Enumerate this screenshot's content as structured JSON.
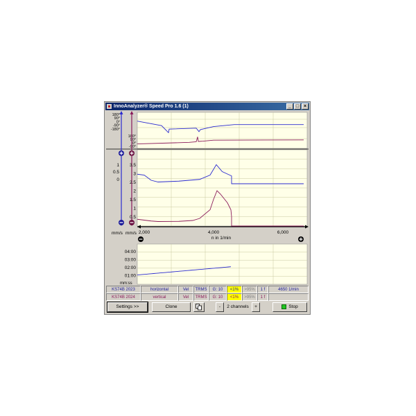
{
  "window": {
    "title": "InnoAnalyzer® Speed Pro 1.6 (1)"
  },
  "colors": {
    "trace_top": "#2a2ad0",
    "trace_bottom": "#8a1a5a",
    "plot_bg": "#ffffe8",
    "grid": "#c8c8a0",
    "yellow": "#ffff00"
  },
  "chart_data": [
    {
      "type": "line",
      "panel": "phase",
      "ytick_labels_ch1": [
        "180°",
        "90°",
        "0°",
        "-90°",
        "-180°"
      ],
      "ytick_labels_ch2": [
        "180°",
        "90°",
        "0°",
        "-90°"
      ],
      "series": [
        {
          "values": [
            [
              1800,
              60
            ],
            [
              2500,
              -30
            ],
            [
              2700,
              -170
            ],
            [
              2720,
              -100
            ],
            [
              3500,
              -80
            ],
            [
              3580,
              -150
            ],
            [
              3620,
              -110
            ],
            [
              4000,
              -50
            ],
            [
              4600,
              -10
            ],
            [
              6600,
              -10
            ]
          ]
        },
        {
          "values": [
            [
              1800,
              -170
            ],
            [
              3300,
              -120
            ],
            [
              3500,
              -100
            ],
            [
              3540,
              60
            ],
            [
              3560,
              -90
            ],
            [
              3700,
              -80
            ],
            [
              4000,
              -50
            ],
            [
              6600,
              -40
            ]
          ]
        }
      ]
    },
    {
      "type": "line",
      "panel": "velocity",
      "xlabel": "n in 1/min",
      "xticks": [
        "2,000",
        "4,000",
        "6,000"
      ],
      "xlim": [
        1800,
        6700
      ],
      "ylabel_left": "mm/s",
      "ylabel_right": "mm/s",
      "yticks_left": [
        "1",
        "0.5",
        "0"
      ],
      "yticks_right": [
        "3.5",
        "3",
        "2.5",
        "2",
        "1.5",
        "1",
        "0.5"
      ],
      "series": [
        {
          "values": [
            [
              1800,
              3.05
            ],
            [
              2000,
              3.0
            ],
            [
              2200,
              2.7
            ],
            [
              2400,
              2.6
            ],
            [
              3000,
              2.65
            ],
            [
              3600,
              2.75
            ],
            [
              3900,
              3.0
            ],
            [
              4080,
              3.6
            ],
            [
              4250,
              3.2
            ],
            [
              4520,
              2.95
            ],
            [
              4520,
              2.5
            ],
            [
              6600,
              2.5
            ]
          ]
        },
        {
          "values": [
            [
              1800,
              0.45
            ],
            [
              2000,
              0.4
            ],
            [
              2200,
              0.35
            ],
            [
              2400,
              0.32
            ],
            [
              3000,
              0.33
            ],
            [
              3400,
              0.38
            ],
            [
              3600,
              0.5
            ],
            [
              3900,
              1.0
            ],
            [
              4000,
              1.6
            ],
            [
              4100,
              2.1
            ],
            [
              4200,
              1.9
            ],
            [
              4400,
              1.4
            ],
            [
              4500,
              1.0
            ],
            [
              4520,
              0.6
            ],
            [
              4520,
              0.0
            ],
            [
              6600,
              0.0
            ]
          ]
        }
      ]
    },
    {
      "type": "line",
      "panel": "time",
      "ylabel": "mm:ss",
      "yticks": [
        "04:00",
        "03:00",
        "02:00",
        "01:00"
      ],
      "series": [
        {
          "values": [
            [
              0,
              70
            ],
            [
              1,
              132
            ]
          ]
        }
      ]
    }
  ],
  "status": {
    "rows": [
      {
        "sensor": "KS74B 2023",
        "direction": "horizontal",
        "quantity": "Vel",
        "mode": "TRMS",
        "gain": "G: 10",
        "low": "<1%",
        "high": ">95%",
        "f": "1 f",
        "speed": "4650 1/min"
      },
      {
        "sensor": "KS74B 2024",
        "direction": "vertical",
        "quantity": "Vel",
        "mode": "TRMS",
        "gain": "G: 10",
        "low": "<1%",
        "high": ">95%",
        "f": "1 f",
        "speed": ""
      }
    ]
  },
  "toolbar": {
    "settings": "Settings >>",
    "clone": "Clone",
    "minus": "-",
    "channels": "2 channels",
    "plus": "+",
    "stop": "Stop"
  }
}
